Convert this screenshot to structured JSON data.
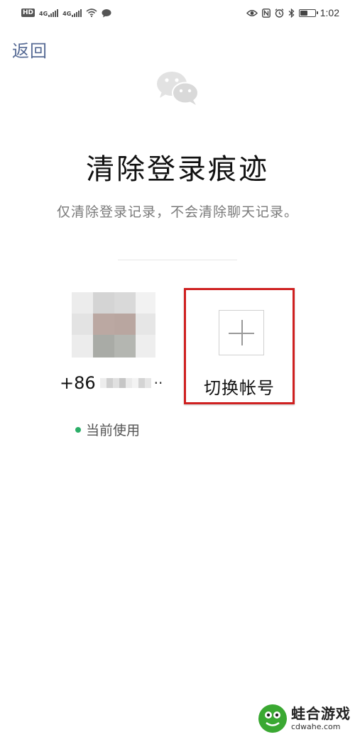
{
  "status_bar": {
    "hd_label": "HD",
    "net_1": "4G",
    "net_2": "4G",
    "time": "1:02",
    "battery_level": 0.55,
    "icons": [
      "wifi-icon",
      "message-icon",
      "eye-icon",
      "nfc-icon",
      "alarm-icon",
      "bluetooth-icon"
    ]
  },
  "nav": {
    "back_label": "返回"
  },
  "header": {
    "title": "清除登录痕迹",
    "subtitle": "仅清除登录记录，不会清除聊天记录。"
  },
  "accounts": {
    "current": {
      "phone_prefix": "+86",
      "phone_ellipsis": "··",
      "status_label": "当前使用"
    },
    "switch": {
      "label": "切换帐号"
    }
  },
  "watermark": {
    "name": "蛙合游戏",
    "url": "cdwahe.com"
  },
  "colors": {
    "link": "#576b95",
    "highlight_border": "#cf2020",
    "status_dot": "#2aae67"
  }
}
